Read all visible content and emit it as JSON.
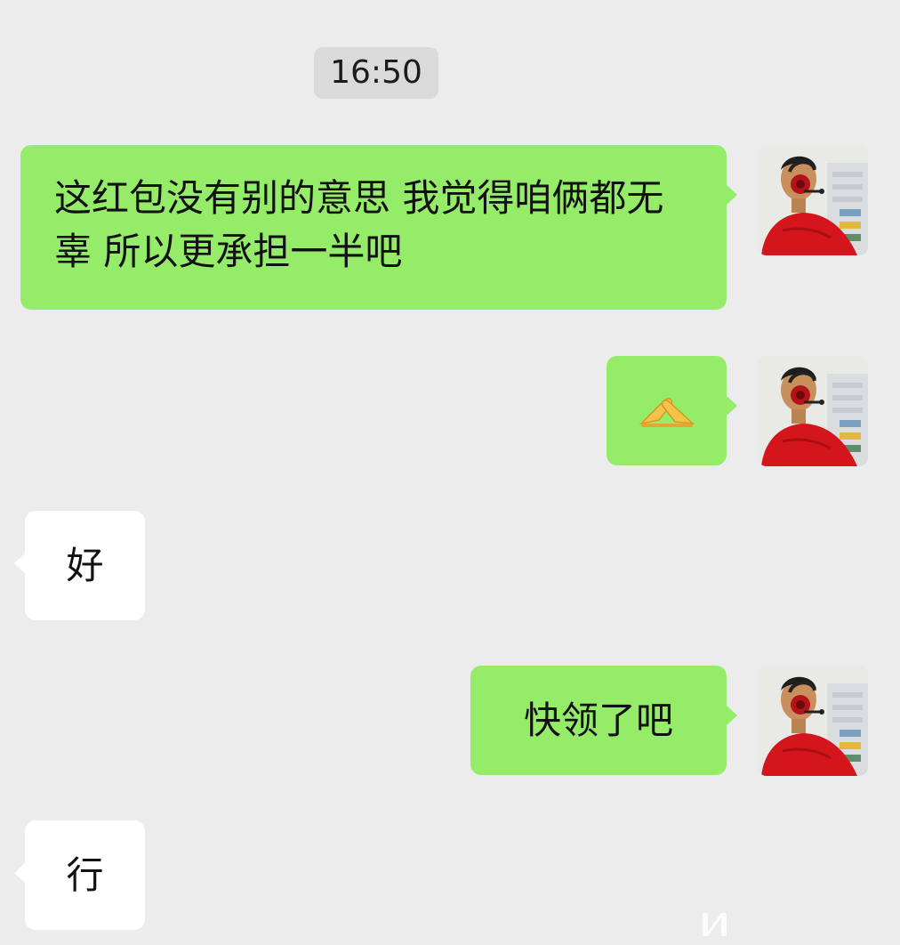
{
  "chat": {
    "timestamp": "16:50",
    "messages": [
      {
        "side": "me",
        "text": "这红包没有别的意思 我觉得咱俩都无辜 所以更承担一半吧"
      },
      {
        "side": "me",
        "text": "🫴🫲"
      },
      {
        "side": "them",
        "text": "好"
      },
      {
        "side": "me",
        "text": "快领了吧"
      },
      {
        "side": "them",
        "text": "行"
      }
    ]
  },
  "colors": {
    "background": "#ececec",
    "me_bubble": "#95ec69",
    "them_bubble": "#ffffff",
    "timestamp_bg": "#dadada"
  },
  "icons": {
    "avatar": "man-in-red-jacket-with-headset-avatar",
    "emoji": "handshake-gesture-icon"
  }
}
